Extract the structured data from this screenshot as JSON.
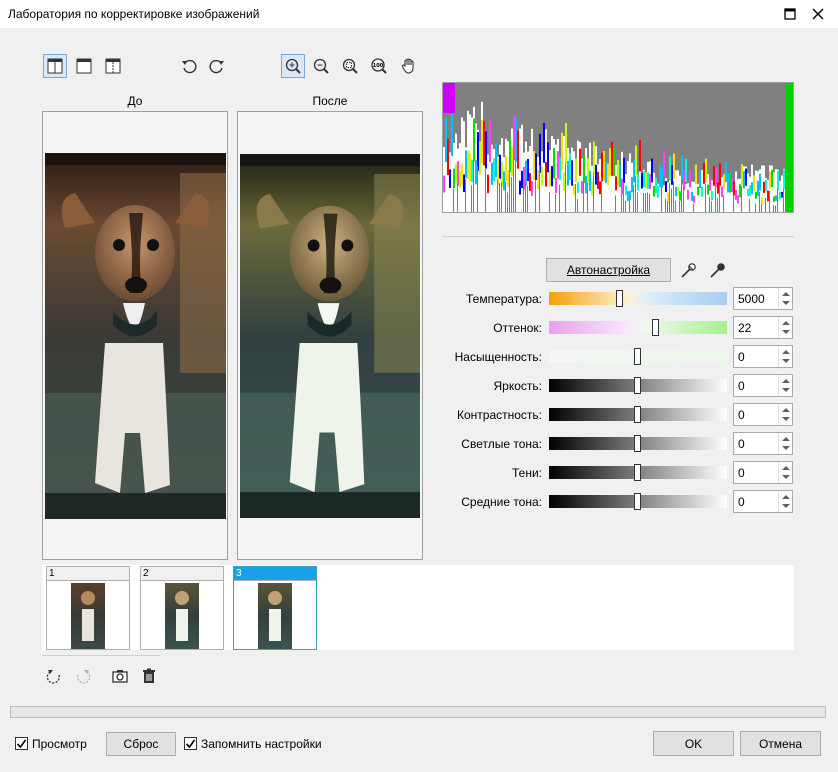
{
  "window": {
    "title": "Лаборатория по корректировке изображений"
  },
  "toolbar": {
    "view_buttons": [
      "split-view-icon",
      "single-view-icon",
      "split-preview-icon"
    ],
    "rotate_buttons": [
      "rotate-left-icon",
      "rotate-right-icon"
    ],
    "zoom_buttons": [
      "zoom-in-icon",
      "zoom-out-icon",
      "zoom-fit-icon",
      "zoom-100-icon",
      "pan-hand-icon"
    ]
  },
  "panes": {
    "before_label": "До",
    "after_label": "После"
  },
  "controls": {
    "auto_button": "Автонастройка",
    "eyedroppers": [
      "eyedropper-white-icon",
      "eyedropper-black-icon"
    ],
    "sliders": [
      {
        "label": "Температура:",
        "value": "5000",
        "position": 0.4
      },
      {
        "label": "Оттенок:",
        "value": "22",
        "position": 0.6
      },
      {
        "label": "Насыщенность:",
        "value": "0",
        "position": 0.5
      },
      {
        "label": "Яркость:",
        "value": "0",
        "position": 0.5
      },
      {
        "label": "Контрастность:",
        "value": "0",
        "position": 0.5
      },
      {
        "label": "Светлые тона:",
        "value": "0",
        "position": 0.5
      },
      {
        "label": "Тени:",
        "value": "0",
        "position": 0.5
      },
      {
        "label": "Средние тона:",
        "value": "0",
        "position": 0.5
      }
    ]
  },
  "snapshots": [
    {
      "label": "1",
      "selected": false
    },
    {
      "label": "2",
      "selected": false
    },
    {
      "label": "3",
      "selected": true
    }
  ],
  "snapshot_tools": [
    "undo-icon",
    "redo-icon",
    "camera-icon",
    "trash-icon"
  ],
  "footer": {
    "preview_label": "Просмотр",
    "preview_checked": true,
    "reset_button": "Сброс",
    "remember_label": "Запомнить настройки",
    "remember_checked": true,
    "ok_button": "OK",
    "cancel_button": "Отмена"
  }
}
